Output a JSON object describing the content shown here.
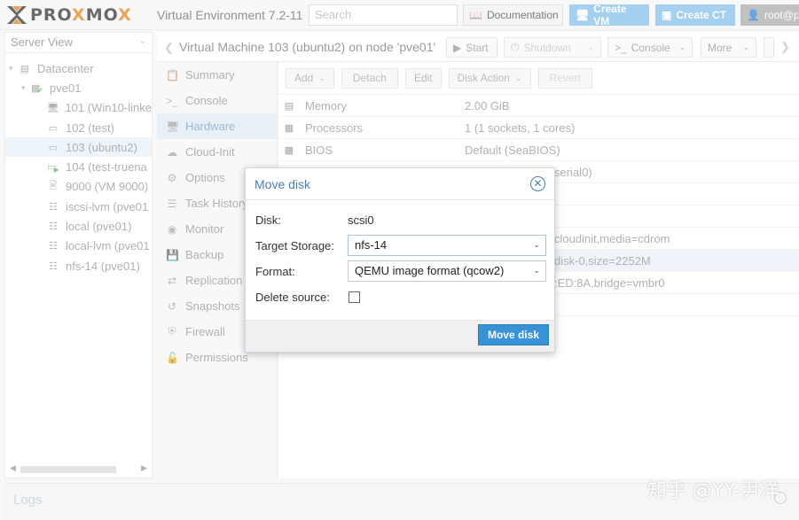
{
  "header": {
    "logo_prefix": "PRO",
    "logo_x": "X",
    "logo_mid": "MO",
    "logo_x2": "X",
    "app_title": "Virtual Environment 7.2-11",
    "search_placeholder": "Search",
    "documentation": "Documentation",
    "create_vm": "Create VM",
    "create_ct": "Create CT",
    "user": "root@pa"
  },
  "tree": {
    "view": "Server View",
    "items": [
      {
        "label": "Datacenter",
        "icon": "datacenter-icon"
      },
      {
        "label": "pve01",
        "icon": "node-icon"
      },
      {
        "label": "101 (Win10-linke",
        "icon": "vm-icon"
      },
      {
        "label": "102 (test)",
        "icon": "vm-icon"
      },
      {
        "label": "103 (ubuntu2)",
        "icon": "vm-icon"
      },
      {
        "label": "104 (test-truena",
        "icon": "vm-running-icon"
      },
      {
        "label": "9000 (VM 9000)",
        "icon": "template-icon"
      },
      {
        "label": "iscsi-lvm (pve01",
        "icon": "storage-icon"
      },
      {
        "label": "local (pve01)",
        "icon": "storage-icon"
      },
      {
        "label": "local-lvm (pve01",
        "icon": "storage-icon"
      },
      {
        "label": "nfs-14 (pve01)",
        "icon": "storage-icon"
      }
    ]
  },
  "content": {
    "title": "Virtual Machine 103 (ubuntu2) on node 'pve01'",
    "start": "Start",
    "shutdown": "Shutdown",
    "console": "Console",
    "more": "More"
  },
  "nav": [
    {
      "label": "Summary",
      "icon": "summary-icon"
    },
    {
      "label": "Console",
      "icon": "console-icon"
    },
    {
      "label": "Hardware",
      "icon": "hardware-icon"
    },
    {
      "label": "Cloud-Init",
      "icon": "cloud-icon"
    },
    {
      "label": "Options",
      "icon": "gear-icon"
    },
    {
      "label": "Task History",
      "icon": "list-icon"
    },
    {
      "label": "Monitor",
      "icon": "eye-icon"
    },
    {
      "label": "Backup",
      "icon": "floppy-icon"
    },
    {
      "label": "Replication",
      "icon": "retweet-icon"
    },
    {
      "label": "Snapshots",
      "icon": "history-icon"
    },
    {
      "label": "Firewall",
      "icon": "shield-icon"
    },
    {
      "label": "Permissions",
      "icon": "unlock-icon"
    }
  ],
  "hw_toolbar": {
    "add": "Add",
    "detach": "Detach",
    "edit": "Edit",
    "disk_action": "Disk Action",
    "revert": "Revert"
  },
  "hw_rows": [
    {
      "name": "Memory",
      "value": "2.00 GiB",
      "icon": "memory-icon"
    },
    {
      "name": "Processors",
      "value": "1 (1 sockets, 1 cores)",
      "icon": "cpu-icon"
    },
    {
      "name": "BIOS",
      "value": "Default (SeaBIOS)",
      "icon": "microchip-icon"
    },
    {
      "name": "",
      "value": "serial0)",
      "icon": ""
    },
    {
      "name": "",
      "value": "",
      "icon": ""
    },
    {
      "name": "",
      "value": "",
      "icon": ""
    },
    {
      "name": "",
      "value": "cloudinit,media=cdrom",
      "icon": ""
    },
    {
      "name": "",
      "value": "disk-0,size=2252M",
      "icon": ""
    },
    {
      "name": "",
      "value": ":ED:8A,bridge=vmbr0",
      "icon": ""
    },
    {
      "name": "",
      "value": "",
      "icon": ""
    }
  ],
  "modal": {
    "title": "Move disk",
    "disk_label": "Disk:",
    "disk_value": "scsi0",
    "target_label": "Target Storage:",
    "target_value": "nfs-14",
    "format_label": "Format:",
    "format_value": "QEMU image format (qcow2)",
    "delete_label": "Delete source:",
    "delete_checked": false,
    "submit": "Move disk"
  },
  "footer": {
    "logs": "Logs",
    "watermark": "知乎 @YY-尹洋"
  },
  "colors": {
    "brand_orange": "#e57000",
    "accent_blue": "#3892d4",
    "create_button": "#76b7e6"
  }
}
